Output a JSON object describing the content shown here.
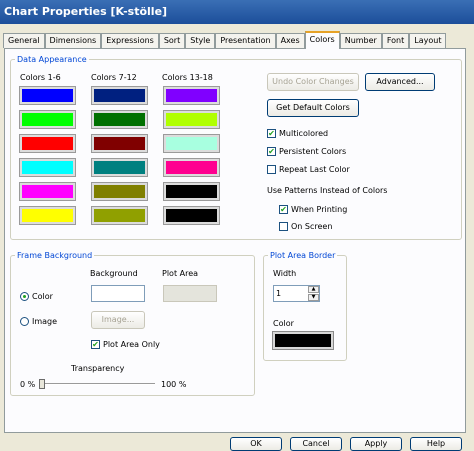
{
  "window": {
    "title": "Chart Properties [K-stölle]"
  },
  "tabs": [
    {
      "label": "General"
    },
    {
      "label": "Dimensions"
    },
    {
      "label": "Expressions"
    },
    {
      "label": "Sort"
    },
    {
      "label": "Style"
    },
    {
      "label": "Presentation"
    },
    {
      "label": "Axes"
    },
    {
      "label": "Colors"
    },
    {
      "label": "Number"
    },
    {
      "label": "Font"
    },
    {
      "label": "Layout"
    }
  ],
  "active_tab": "Colors",
  "data_appearance": {
    "legend": "Data Appearance",
    "col_headers": [
      "Colors 1-6",
      "Colors 7-12",
      "Colors 13-18"
    ],
    "colors": [
      [
        "#0000ff",
        "#00ff00",
        "#ff0000",
        "#00ffff",
        "#ff00ff",
        "#ffff00"
      ],
      [
        "#002080",
        "#007000",
        "#800000",
        "#008080",
        "#808000",
        "#90a000"
      ],
      [
        "#8000ff",
        "#b0ff00",
        "#a8ffe0",
        "#ff0090",
        "#000000",
        "#000000"
      ]
    ],
    "undo_button": "Undo Color Changes",
    "advanced_button": "Advanced...",
    "default_button": "Get Default Colors",
    "multicolored": "Multicolored",
    "persistent": "Persistent Colors",
    "repeat_last": "Repeat Last Color",
    "patterns_label": "Use Patterns Instead of Colors",
    "when_printing": "When Printing",
    "on_screen": "On Screen",
    "checked": {
      "multicolored": true,
      "persistent": true,
      "repeat_last": false,
      "when_printing": true,
      "on_screen": false
    }
  },
  "frame_background": {
    "legend": "Frame Background",
    "background_header": "Background",
    "plot_area_header": "Plot Area",
    "color_option": "Color",
    "image_option": "Image",
    "image_button": "Image...",
    "plot_area_only": "Plot Area Only",
    "transparency_label": "Transparency",
    "transparency_min": "0 %",
    "transparency_max": "100 %",
    "transparency_value": 0
  },
  "plot_area_border": {
    "legend": "Plot Area Border",
    "width_label": "Width",
    "width_value": "1",
    "color_label": "Color",
    "color": "#000000"
  },
  "footer_buttons": [
    "OK",
    "Cancel",
    "Apply",
    "Help"
  ]
}
